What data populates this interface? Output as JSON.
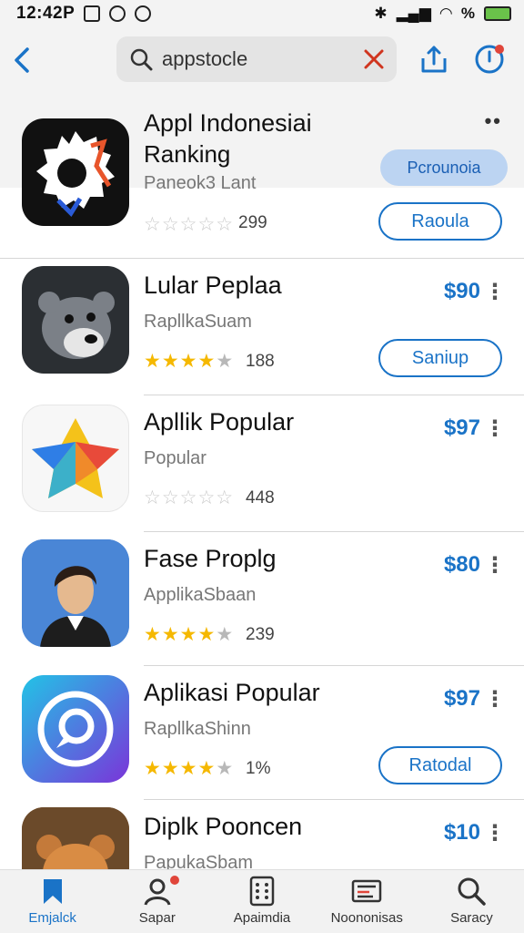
{
  "status_bar": {
    "time": "12:42P",
    "signal_text": "%"
  },
  "header": {
    "search_value": "appstocle",
    "icons": {
      "back": "chevron-left-icon",
      "search": "search-icon",
      "clear": "close-icon",
      "share": "share-icon",
      "update": "update-icon"
    }
  },
  "featured": {
    "title": "Appl Indonesiai",
    "subtitle": "Ranking",
    "developer": "Paneok3 Lant",
    "rating": 0,
    "rating_count": "299",
    "top_button": "Pcrounoia",
    "action_label": "Raoula"
  },
  "apps": [
    {
      "title": "Lular Peplaa",
      "subtitle": "RapllkaSuam",
      "rating": 4,
      "rating_count": "188",
      "price": "$90",
      "action_label": "Saniup"
    },
    {
      "title": "Apllik Popular",
      "subtitle": "Popular",
      "rating": 0,
      "rating_count": "448",
      "price": "$97",
      "action_label": ""
    },
    {
      "title": "Fase Proplg",
      "subtitle": "ApplikaSbaan",
      "rating": 4,
      "rating_count": "239",
      "price": "$80",
      "action_label": ""
    },
    {
      "title": "Aplikasi Popular",
      "subtitle": "RapllkaShinn",
      "rating": 4,
      "rating_count": "1%",
      "price": "$97",
      "action_label": "Ratodal"
    },
    {
      "title": "Diplk Pooncen",
      "subtitle": "PapukaSbam",
      "rating": 0,
      "rating_count": "",
      "price": "$10",
      "action_label": ""
    }
  ],
  "tabs": [
    {
      "label": "Emjalck",
      "icon": "bookmark-icon",
      "active": true
    },
    {
      "label": "Sapar",
      "icon": "person-icon",
      "active": false
    },
    {
      "label": "Apaimdia",
      "icon": "grid-icon",
      "active": false
    },
    {
      "label": "Noononisas",
      "icon": "news-icon",
      "active": false
    },
    {
      "label": "Saracy",
      "icon": "search-icon",
      "active": false
    }
  ],
  "colors": {
    "accent": "#1a73c7",
    "star": "#f5b800",
    "clear": "#d0351f"
  }
}
